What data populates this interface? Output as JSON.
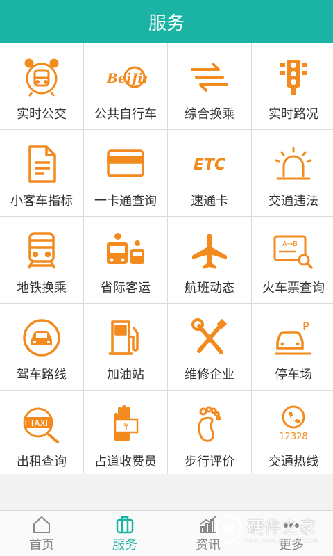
{
  "header": {
    "title": "服务"
  },
  "colors": {
    "accent": "#1bb3a4",
    "icon": "#f28a1e"
  },
  "grid": {
    "items": [
      {
        "label": "实时公交",
        "icon": "alarm-bus-icon"
      },
      {
        "label": "公共自行车",
        "icon": "beijing-bike-icon"
      },
      {
        "label": "综合换乘",
        "icon": "transfer-arrows-icon"
      },
      {
        "label": "实时路况",
        "icon": "traffic-light-icon"
      },
      {
        "label": "小客车指标",
        "icon": "document-icon"
      },
      {
        "label": "一卡通查询",
        "icon": "card-icon"
      },
      {
        "label": "速通卡",
        "icon": "etc-icon"
      },
      {
        "label": "交通违法",
        "icon": "siren-icon"
      },
      {
        "label": "地铁换乘",
        "icon": "subway-icon"
      },
      {
        "label": "省际客运",
        "icon": "coach-bus-icon"
      },
      {
        "label": "航班动态",
        "icon": "airplane-icon"
      },
      {
        "label": "火车票查询",
        "icon": "ticket-search-icon"
      },
      {
        "label": "驾车路线",
        "icon": "car-circle-icon"
      },
      {
        "label": "加油站",
        "icon": "gas-station-icon"
      },
      {
        "label": "维修企业",
        "icon": "tools-icon"
      },
      {
        "label": "停车场",
        "icon": "parking-car-icon"
      },
      {
        "label": "出租查询",
        "icon": "taxi-search-icon"
      },
      {
        "label": "占道收费员",
        "icon": "toll-collector-icon"
      },
      {
        "label": "步行评价",
        "icon": "footprint-icon"
      },
      {
        "label": "交通热线",
        "icon": "hotline-icon"
      }
    ],
    "icon_texts": {
      "beijing": "BeiJing",
      "etc": "ETC",
      "ticket": "A→B",
      "taxi": "TAXI",
      "yen": "¥",
      "hotline": "12328",
      "parking": "P"
    }
  },
  "tabbar": {
    "tabs": [
      {
        "label": "首页",
        "icon": "home-icon",
        "active": false
      },
      {
        "label": "服务",
        "icon": "briefcase-icon",
        "active": true
      },
      {
        "label": "资讯",
        "icon": "chart-icon",
        "active": false
      },
      {
        "label": "更多",
        "icon": "more-dots-icon",
        "active": false
      }
    ]
  },
  "watermark": {
    "text": "硬件之家",
    "sub": "YING JIAN ZHI JIA.COM"
  }
}
